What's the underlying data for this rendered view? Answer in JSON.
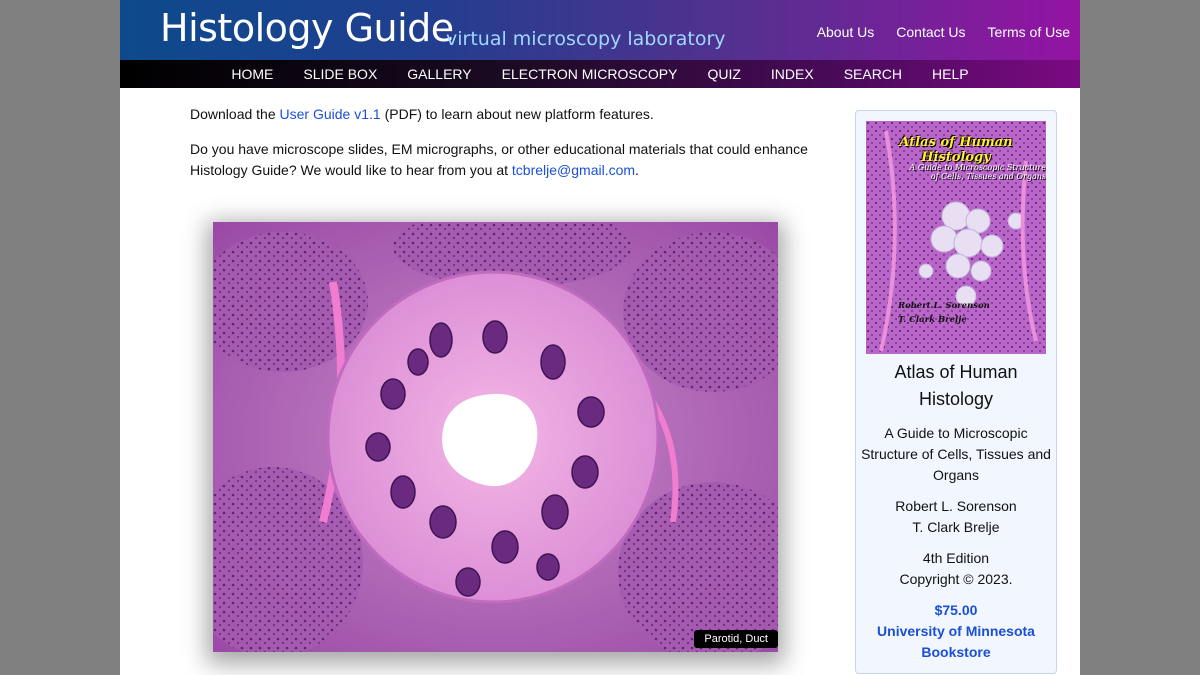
{
  "header": {
    "site_title": "Histology Guide",
    "tagline": "virtual microscopy laboratory",
    "top_links": [
      "About Us",
      "Contact Us",
      "Terms of Use"
    ]
  },
  "nav": {
    "items": [
      "HOME",
      "SLIDE BOX",
      "GALLERY",
      "ELECTRON MICROSCOPY",
      "QUIZ",
      "INDEX",
      "SEARCH",
      "HELP"
    ]
  },
  "main": {
    "download": {
      "prefix": "Download the ",
      "link": "User Guide v1.1",
      "suffix": " (PDF) to learn about new platform features."
    },
    "request": {
      "text": "Do you have microscope slides, EM micrographs, or other educational materials that could enhance Histology Guide? We would like to hear from you at ",
      "email": "tcbrelje@gmail.com",
      "end": "."
    },
    "figure_caption": "Parotid, Duct"
  },
  "sidebar": {
    "cover": {
      "title": "Atlas of Human Histology",
      "subtitle_line1": "A Guide to Microscopic Structure",
      "subtitle_line2": "of Cells, Tissues and Organs",
      "author1": "Robert L. Sorenson",
      "author2": "T. Clark Brelje"
    },
    "book_title": "Atlas of Human Histology",
    "book_subtitle": "A Guide to Microscopic Structure of Cells, Tissues and Organs",
    "author1": "Robert L. Sorenson",
    "author2": "T. Clark Brelje",
    "edition": "4th Edition",
    "copyright": "Copyright © 2023.",
    "price": "$75.00",
    "store": "University of Minnesota Bookstore"
  },
  "colors": {
    "link": "#1a4fd6",
    "page_background": "#808080",
    "banner_start": "#0d4a8c",
    "banner_end": "#9413a3",
    "tagline": "#9fd8ff"
  }
}
